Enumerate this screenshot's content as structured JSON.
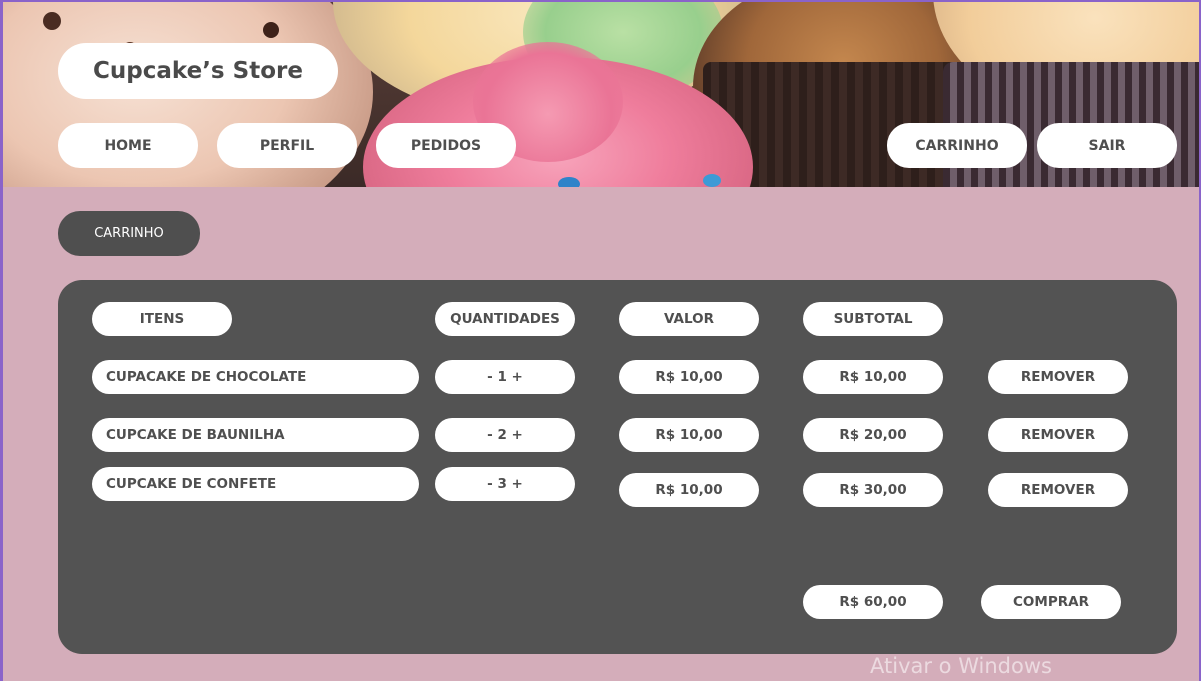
{
  "store": {
    "title": "Cupcake’s Store"
  },
  "nav": {
    "home": "HOME",
    "profile": "PERFIL",
    "orders": "PEDIDOS",
    "cart": "CARRINHO",
    "logout": "SAIR"
  },
  "section": {
    "title": "CARRINHO"
  },
  "cart": {
    "headers": {
      "items": "ITENS",
      "quantity": "QUANTIDADES",
      "value": "VALOR",
      "subtotal": "SUBTOTAL"
    },
    "rows": [
      {
        "name": "CUPACAKE DE CHOCOLATE",
        "quantity": "- 1 +",
        "value": "R$ 10,00",
        "subtotal": "R$ 10,00",
        "remove": "REMOVER"
      },
      {
        "name": "CUPCAKE DE BAUNILHA",
        "quantity": "- 2 +",
        "value": "R$ 10,00",
        "subtotal": "R$ 20,00",
        "remove": "REMOVER"
      },
      {
        "name": "CUPCAKE DE CONFETE",
        "quantity": "- 3 +",
        "value": "R$ 10,00",
        "subtotal": "R$ 30,00",
        "remove": "REMOVER"
      }
    ],
    "total": "R$ 60,00",
    "buy": "COMPRAR"
  },
  "watermark": "Ativar o Windows",
  "colors": {
    "frame_border": "#8a63c9",
    "background": "#d4adba",
    "panel": "#535353",
    "pill": "#ffffff",
    "pill_text": "#4f4f4f"
  }
}
